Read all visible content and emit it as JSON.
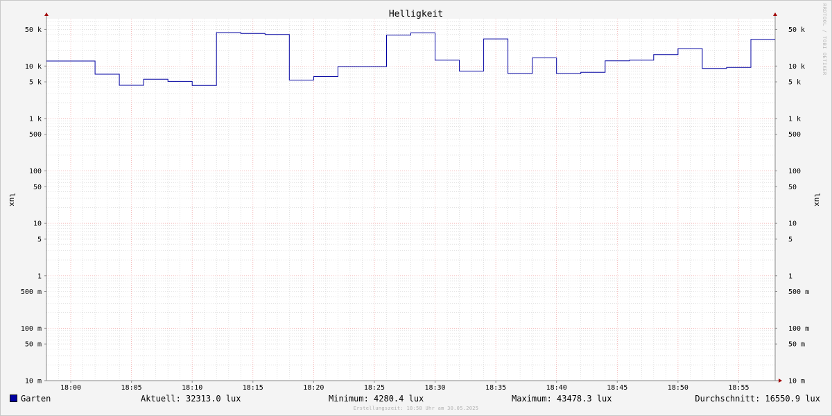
{
  "chart_data": {
    "type": "line",
    "title": "Helligkeit",
    "ylabel": "lux",
    "yscale": "log",
    "ylim": [
      0.01,
      80000
    ],
    "xlim": [
      "17:58",
      "18:58"
    ],
    "grid": true,
    "yticks": [
      {
        "value": 50000,
        "label": "50 k"
      },
      {
        "value": 10000,
        "label": "10 k"
      },
      {
        "value": 5000,
        "label": "5 k"
      },
      {
        "value": 1000,
        "label": "1 k"
      },
      {
        "value": 500,
        "label": "500"
      },
      {
        "value": 100,
        "label": "100"
      },
      {
        "value": 50,
        "label": "50"
      },
      {
        "value": 10,
        "label": "10"
      },
      {
        "value": 5,
        "label": "5"
      },
      {
        "value": 1,
        "label": "1"
      },
      {
        "value": 0.5,
        "label": "500 m"
      },
      {
        "value": 0.1,
        "label": "100 m"
      },
      {
        "value": 0.05,
        "label": "50 m"
      },
      {
        "value": 0.01,
        "label": "10 m"
      }
    ],
    "xticks": [
      "18:00",
      "18:05",
      "18:10",
      "18:15",
      "18:20",
      "18:25",
      "18:30",
      "18:35",
      "18:40",
      "18:45",
      "18:50",
      "18:55"
    ],
    "series": [
      {
        "name": "Garten",
        "color": "#0000a0",
        "points": [
          {
            "t": "17:58",
            "v": 12500
          },
          {
            "t": "18:02",
            "v": 7000
          },
          {
            "t": "18:04",
            "v": 4300
          },
          {
            "t": "18:06",
            "v": 5600
          },
          {
            "t": "18:08",
            "v": 5100
          },
          {
            "t": "18:10",
            "v": 4280.4
          },
          {
            "t": "18:12",
            "v": 43478.3
          },
          {
            "t": "18:14",
            "v": 42000
          },
          {
            "t": "18:16",
            "v": 40000
          },
          {
            "t": "18:18",
            "v": 5400
          },
          {
            "t": "18:20",
            "v": 6300
          },
          {
            "t": "18:22",
            "v": 9800
          },
          {
            "t": "18:26",
            "v": 39000
          },
          {
            "t": "18:28",
            "v": 43000
          },
          {
            "t": "18:30",
            "v": 13000
          },
          {
            "t": "18:32",
            "v": 8000
          },
          {
            "t": "18:34",
            "v": 33000
          },
          {
            "t": "18:36",
            "v": 7200
          },
          {
            "t": "18:38",
            "v": 14300
          },
          {
            "t": "18:40",
            "v": 7200
          },
          {
            "t": "18:42",
            "v": 7600
          },
          {
            "t": "18:44",
            "v": 12600
          },
          {
            "t": "18:46",
            "v": 13000
          },
          {
            "t": "18:48",
            "v": 16500
          },
          {
            "t": "18:50",
            "v": 21500
          },
          {
            "t": "18:52",
            "v": 9000
          },
          {
            "t": "18:54",
            "v": 9400
          },
          {
            "t": "18:56",
            "v": 32313.0
          },
          {
            "t": "18:58",
            "v": 32313.0
          }
        ]
      }
    ]
  },
  "legend": {
    "series_name": "Garten",
    "current": "Aktuell: 32313.0 lux",
    "minimum": "Minimum: 4280.4 lux",
    "maximum": "Maximum: 43478.3 lux",
    "average": "Durchschnitt: 16550.9 lux"
  },
  "watermark": "RRDTOOL / TOBI OETIKER",
  "footer": "Erstellungszeit: 18:58 Uhr am 30.05.2025",
  "colors": {
    "line": "#0000a0",
    "major_grid": "#f0a0a0",
    "minor_grid": "#d0d0d0",
    "axis_arrow": "#a00000",
    "plot_background": "#ffffff"
  }
}
